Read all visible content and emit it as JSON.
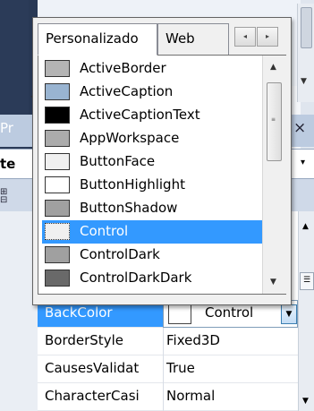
{
  "background": {
    "panel_title_partial": "Pr",
    "object_combo_partial": "te",
    "toolbar_partial": "⊞\n⊟",
    "close_glyph": "×",
    "combo_arrow": "▾",
    "left_arrow": "◂"
  },
  "tabs": [
    {
      "label": "Personalizado",
      "active": true
    },
    {
      "label": "Web",
      "active": false
    }
  ],
  "tab_scroll": {
    "left": "◂",
    "right": "▸"
  },
  "color_list": {
    "items": [
      {
        "label": "ActiveBorder",
        "color": "#b4b4b4"
      },
      {
        "label": "ActiveCaption",
        "color": "#99b4d1"
      },
      {
        "label": "ActiveCaptionText",
        "color": "#000000"
      },
      {
        "label": "AppWorkspace",
        "color": "#ababab"
      },
      {
        "label": "ButtonFace",
        "color": "#f0f0f0"
      },
      {
        "label": "ButtonHighlight",
        "color": "#ffffff"
      },
      {
        "label": "ButtonShadow",
        "color": "#a0a0a0"
      },
      {
        "label": "Control",
        "color": "#f0f0f0",
        "selected": true
      },
      {
        "label": "ControlDark",
        "color": "#a0a0a0"
      },
      {
        "label": "ControlDarkDark",
        "color": "#696969"
      }
    ],
    "scroll_up": "▲",
    "scroll_down": "▼",
    "grip": "≡"
  },
  "properties": [
    {
      "name": "BackColor",
      "value": "Control",
      "selected": true,
      "swatch": "#ffffff"
    },
    {
      "name": "BorderStyle",
      "value": "Fixed3D"
    },
    {
      "name": "CausesValidat",
      "value": "True"
    },
    {
      "name": "CharacterCasi",
      "value": "Normal"
    }
  ],
  "dropdown_glyph": "▼",
  "grid_scroll": {
    "up": "▲",
    "down": "▼",
    "box": "☰"
  }
}
